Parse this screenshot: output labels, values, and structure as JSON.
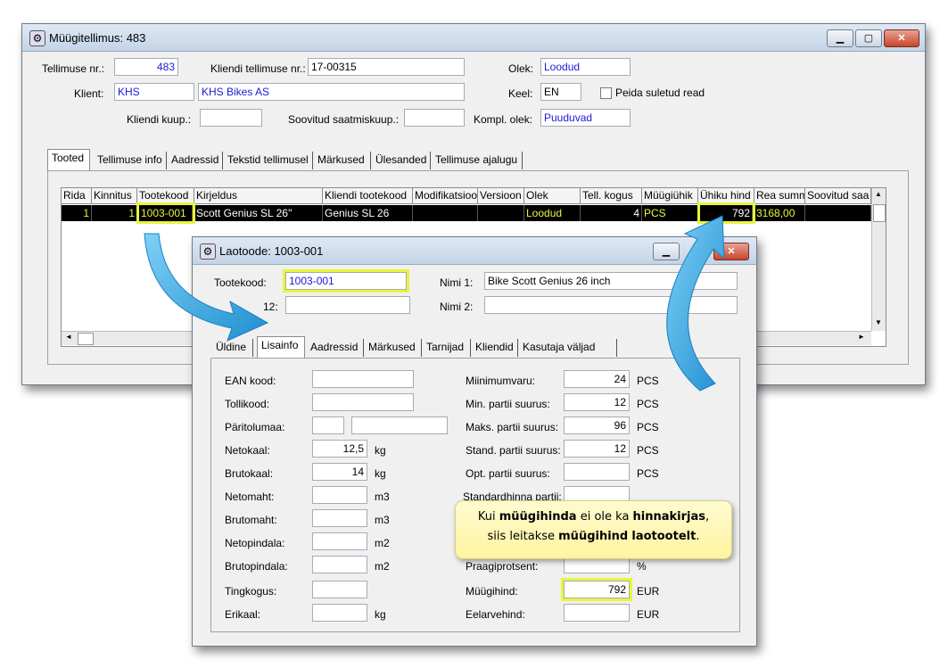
{
  "main_window": {
    "title": "Müügitellimus: 483",
    "fields": {
      "order_no_label": "Tellimuse nr.:",
      "order_no": "483",
      "client_order_label": "Kliendi tellimuse nr.:",
      "client_order": "17-00315",
      "status_label": "Olek:",
      "status": "Loodud",
      "client_label": "Klient:",
      "client_code": "KHS",
      "client_name": "KHS Bikes AS",
      "language_label": "Keel:",
      "language": "EN",
      "hide_closed_label": "Peida suletud read",
      "client_date_label": "Kliendi kuup.:",
      "client_date": "",
      "delivery_date_label": "Soovitud saatmiskuup.:",
      "delivery_date": "",
      "compl_status_label": "Kompl. olek:",
      "compl_status": "Puuduvad"
    },
    "tabs": [
      "Tooted",
      "Tellimuse info",
      "Aadressid",
      "Tekstid tellimusel",
      "Märkused",
      "Ülesanded",
      "Tellimuse ajalugu"
    ],
    "grid": {
      "columns": [
        "Rida",
        "Kinnitus",
        "Tootekood",
        "Kirjeldus",
        "Kliendi tootekood",
        "Modifikatsioo",
        "Versioon",
        "Olek",
        "Tell. kogus",
        "Müügiühik",
        "Ühiku hind",
        "Rea summ",
        "Soovitud saa"
      ],
      "row": [
        "1",
        "1",
        "1003-001",
        "Scott Genius SL 26''",
        "Genius SL 26",
        "",
        "",
        "Loodud",
        "4",
        "PCS",
        "792",
        "3168,00",
        ""
      ]
    }
  },
  "product_window": {
    "title": "Laotoode: 1003-001",
    "product_code_label": "Tootekood:",
    "product_code": "1003-001",
    "name1_label": "Nimi 1:",
    "name1": "Bike Scott Genius 26 inch",
    "field2_label": "12:",
    "field2": "",
    "name2_label": "Nimi 2:",
    "name2": "",
    "tabs": [
      "Üldine",
      "Lisainfo",
      "Aadressid",
      "Märkused",
      "Tarnijad",
      "Kliendid",
      "Kasutaja väljad"
    ],
    "left_fields": [
      {
        "label": "EAN kood:",
        "value": "",
        "unit": ""
      },
      {
        "label": "Tollikood:",
        "value": "",
        "unit": ""
      },
      {
        "label": "Päritolumaa:",
        "value": "",
        "value2": "",
        "unit": ""
      },
      {
        "label": "Netokaal:",
        "value": "12,5",
        "unit": "kg"
      },
      {
        "label": "Brutokaal:",
        "value": "14",
        "unit": "kg"
      },
      {
        "label": "Netomaht:",
        "value": "",
        "unit": "m3"
      },
      {
        "label": "Brutomaht:",
        "value": "",
        "unit": "m3"
      },
      {
        "label": "Netopindala:",
        "value": "",
        "unit": "m2"
      },
      {
        "label": "Brutopindala:",
        "value": "",
        "unit": "m2"
      },
      {
        "label": "Tingkogus:",
        "value": "",
        "unit": ""
      },
      {
        "label": "Erikaal:",
        "value": "",
        "unit": "kg"
      }
    ],
    "right_fields": [
      {
        "label": "Miinimumvaru:",
        "value": "24",
        "unit": "PCS"
      },
      {
        "label": "Min. partii suurus:",
        "value": "12",
        "unit": "PCS"
      },
      {
        "label": "Maks. partii suurus:",
        "value": "96",
        "unit": "PCS"
      },
      {
        "label": "Stand. partii suurus:",
        "value": "12",
        "unit": "PCS"
      },
      {
        "label": "Opt. partii suurus:",
        "value": "",
        "unit": "PCS"
      },
      {
        "label": "Standardhinna partii:",
        "value": "",
        "unit": ""
      },
      {
        "label": "Praagiprotsent:",
        "value": "",
        "unit": "%"
      },
      {
        "label": "Müügihind:",
        "value": "792",
        "unit": "EUR"
      },
      {
        "label": "Eelarvehind:",
        "value": "",
        "unit": "EUR"
      }
    ]
  },
  "callout": {
    "line1_pre": "Kui ",
    "line1_bold1": "müügihinda",
    "line1_mid": " ei ole ka ",
    "line1_bold2": "hinnakirjas",
    "line1_post": ",",
    "line2_pre": "siis leitakse ",
    "line2_bold1": "müügihind",
    "line2_mid": " ",
    "line2_bold2": "laotootelt",
    "line2_post": "."
  },
  "colors": {
    "highlight": "#e8f53a",
    "arrow": "#2aa3e0",
    "selected_row": "#000000",
    "link_text": "#1a1ad8"
  }
}
